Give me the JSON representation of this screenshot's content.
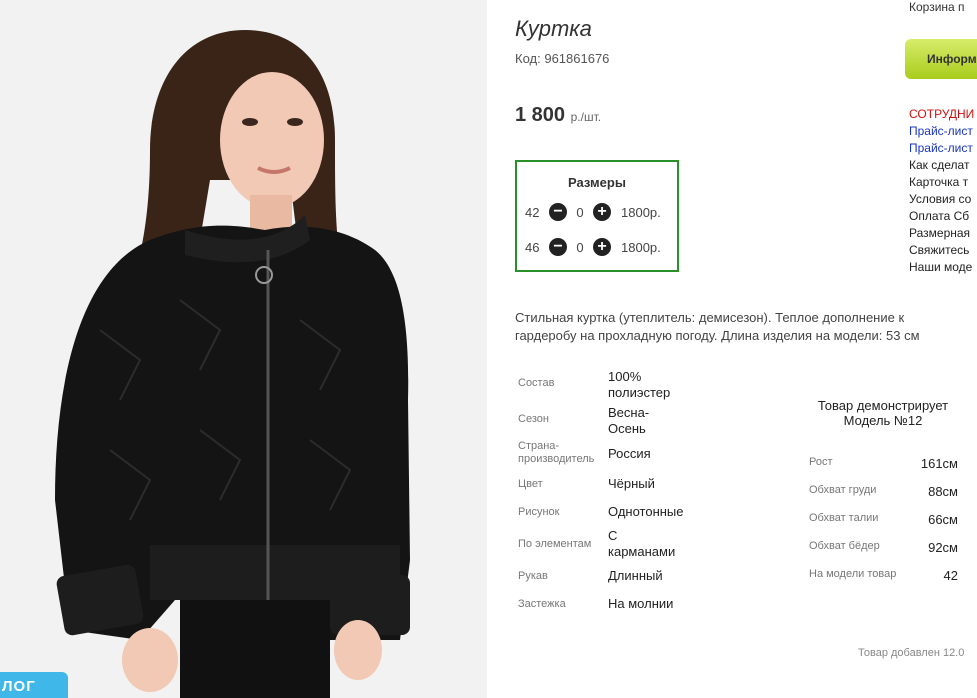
{
  "product": {
    "title": "Куртка",
    "code_label": "Код:",
    "code": "961861676",
    "price": "1 800",
    "price_unit": "р./шт."
  },
  "sizes": {
    "title": "Размеры",
    "rows": [
      {
        "size": "42",
        "qty": "0",
        "price": "1800р."
      },
      {
        "size": "46",
        "qty": "0",
        "price": "1800р."
      }
    ]
  },
  "description": "Стильная куртка (утеплитель: демисезон). Теплое дополнение к гардеробу на прохладную погоду. Длина изделия на модели: 53 см",
  "specs": [
    {
      "key": "Состав",
      "value": "100% полиэстер"
    },
    {
      "key": "Сезон",
      "value": "Весна-Осень"
    },
    {
      "key": "Страна-производитель",
      "value": "Россия"
    },
    {
      "key": "Цвет",
      "value": "Чёрный"
    },
    {
      "key": "Рисунок",
      "value": "Однотонные"
    },
    {
      "key": "По элементам",
      "value": "С карманами"
    },
    {
      "key": "Рукав",
      "value": "Длинный"
    },
    {
      "key": "Застежка",
      "value": "На молнии"
    }
  ],
  "model": {
    "title": "Товар демонстрирует Модель №12",
    "rows": [
      {
        "key": "Рост",
        "value": "161см"
      },
      {
        "key": "Обхват груди",
        "value": "88см"
      },
      {
        "key": "Обхват талии",
        "value": "66см"
      },
      {
        "key": "Обхват бёдер",
        "value": "92см"
      },
      {
        "key": "На модели товар",
        "value": "42"
      }
    ]
  },
  "added": "Товар добавлен 12.0",
  "sidebar": {
    "cart": "Корзина п",
    "info_button": "Информ",
    "links": [
      "СОТРУДНИ",
      "Прайс-лист",
      "Прайс-лист",
      "Как сделат",
      "Карточка т",
      "Условия со",
      "Оплата Сб",
      "Размерная",
      "Свяжитесь",
      "Наши моде"
    ]
  },
  "badge": "ЛОГ",
  "colors": {
    "accent_green": "#27912a",
    "badge_blue": "#3fb7e8",
    "info_green": "#a9cc1c",
    "link_blue": "#1a35c0",
    "alert_red": "#d01010"
  },
  "icons": {
    "minus": "minus-circle-icon",
    "plus": "plus-circle-icon"
  }
}
